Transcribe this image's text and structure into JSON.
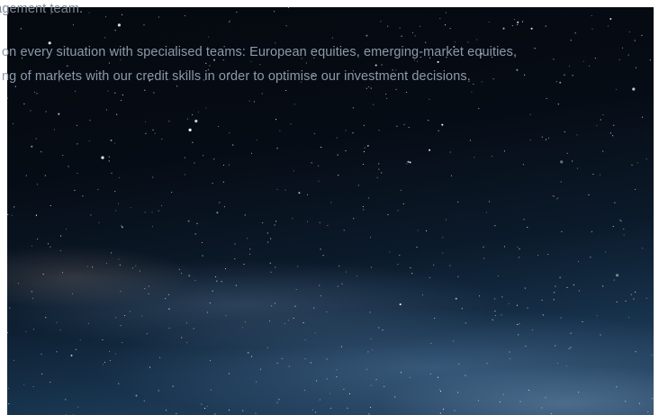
{
  "hero": {
    "lines": [
      "nagement team.",
      "on every situation with specialised teams: European equities, emerging-market equities,",
      "ng of markets with our credit skills in order to optimise our investment decisions."
    ]
  },
  "colors": {
    "sky_top": "#05090f",
    "sky_bottom": "#2a4a68",
    "text": "#8d99aa",
    "page_background": "#ffffff"
  }
}
